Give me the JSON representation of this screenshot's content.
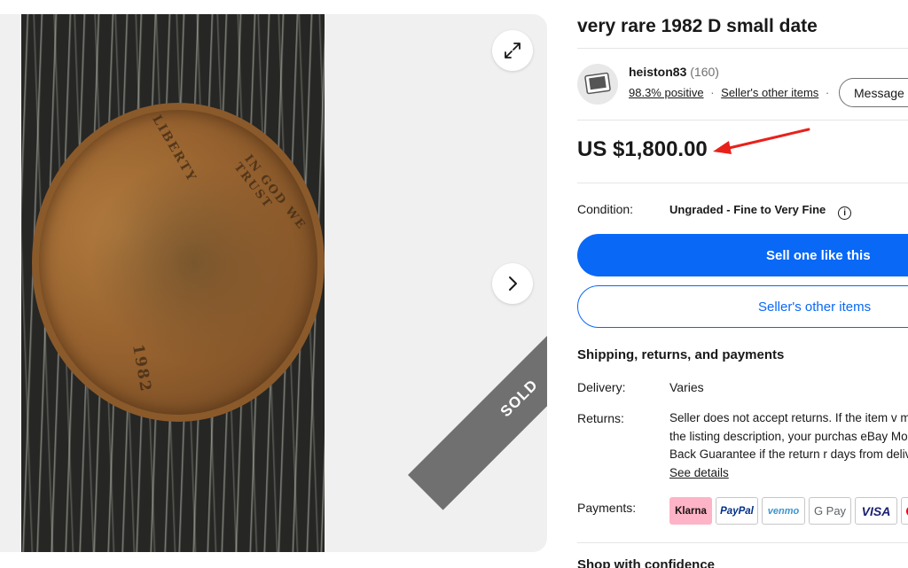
{
  "listing": {
    "title": "very rare 1982 D small date",
    "status_overlay": "SOLD",
    "coin_text": {
      "liberty": "LIBERTY",
      "motto": "IN GOD WE TRUST",
      "year": "1982"
    }
  },
  "seller": {
    "name": "heiston83",
    "count": "(160)",
    "feedback": "98.3% positive",
    "other_items_link": "Seller's other items",
    "separator": "·",
    "message_button": "Message"
  },
  "price": "US $1,800.00",
  "condition": {
    "label": "Condition:",
    "value": "Ungraded - Fine to Very Fine",
    "info_glyph": "i"
  },
  "actions": {
    "primary": "Sell one like this",
    "secondary": "Seller's other items"
  },
  "shipping": {
    "section_title": "Shipping, returns, and payments",
    "delivery_label": "Delivery:",
    "delivery_value": "Varies",
    "returns_label": "Returns:",
    "returns_text": "Seller does not accept returns. If the item v match the listing description, your purchas eBay Money Back Guarantee if the return r days from delivery.",
    "returns_link": "See details",
    "payments_label": "Payments:",
    "payment_methods": [
      "Klarna",
      "PayPal",
      "venmo",
      "G Pay",
      "VISA"
    ]
  },
  "footer": {
    "shop_confidence": "Shop with confidence"
  },
  "colors": {
    "accent": "#0968f6",
    "sold_band": "#707070",
    "annotation_arrow": "#e8211a"
  },
  "icons": {
    "expand": "expand-icon",
    "next": "chevron-right-icon",
    "info": "info-icon",
    "avatar": "seller-avatar-icon"
  }
}
